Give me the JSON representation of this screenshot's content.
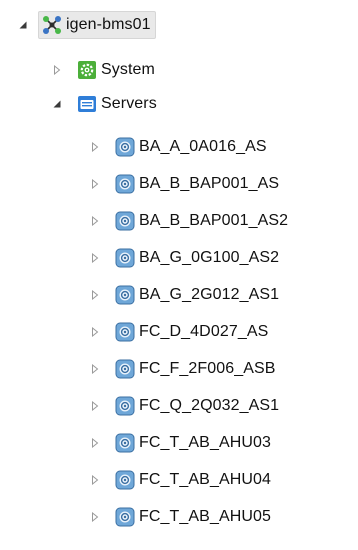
{
  "tree": {
    "root": {
      "label": "igen-bms01",
      "icon": "network-icon",
      "expanded": true,
      "selected": true
    },
    "system": {
      "label": "System",
      "icon": "gear-icon",
      "expanded": false
    },
    "servers": {
      "label": "Servers",
      "icon": "folder-icon",
      "expanded": true,
      "items": [
        {
          "label": "BA_A_0A016_AS",
          "icon": "server-icon"
        },
        {
          "label": "BA_B_BAP001_AS",
          "icon": "server-icon"
        },
        {
          "label": "BA_B_BAP001_AS2",
          "icon": "server-icon"
        },
        {
          "label": "BA_G_0G100_AS2",
          "icon": "server-icon"
        },
        {
          "label": "BA_G_2G012_AS1",
          "icon": "server-icon"
        },
        {
          "label": "FC_D_4D027_AS",
          "icon": "server-icon"
        },
        {
          "label": "FC_F_2F006_ASB",
          "icon": "server-icon"
        },
        {
          "label": "FC_Q_2Q032_AS1",
          "icon": "server-icon"
        },
        {
          "label": "FC_T_AB_AHU03",
          "icon": "server-icon"
        },
        {
          "label": "FC_T_AB_AHU04",
          "icon": "server-icon"
        },
        {
          "label": "FC_T_AB_AHU05",
          "icon": "server-icon"
        }
      ]
    }
  },
  "colors": {
    "selection": "#e9e9e9",
    "network_green": "#48b848",
    "network_blue": "#3a74c4",
    "gear_green": "#4caf3a",
    "folder_blue": "#2f7ed8",
    "server_blue": "#6fa7d8"
  }
}
